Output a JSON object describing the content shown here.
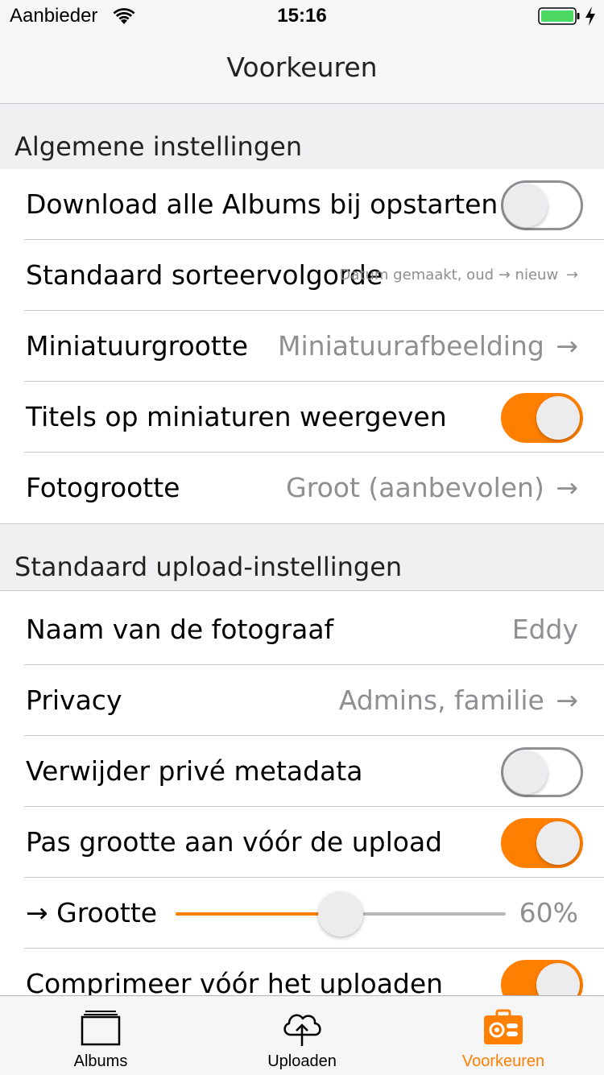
{
  "status_bar": {
    "carrier": "Aanbieder",
    "time": "15:16",
    "battery_color": "#4cd964"
  },
  "nav": {
    "title": "Voorkeuren"
  },
  "accent_color": "#ff7f00",
  "sections": {
    "general": {
      "header": "Algemene instellingen",
      "download_all": {
        "label": "Download alle Albums bij opstarten",
        "on": false
      },
      "sort_order": {
        "label": "Standaard sorteervolgorde",
        "value": "Datum gemaakt, oud → nieuw",
        "arrow": "→"
      },
      "thumbnail_size": {
        "label": "Miniatuurgrootte",
        "value": "Miniatuurafbeelding",
        "arrow": "→"
      },
      "titles_on_thumbs": {
        "label": "Titels op miniaturen weergeven",
        "on": true
      },
      "photo_size": {
        "label": "Fotogrootte",
        "value": "Groot (aanbevolen)",
        "arrow": "→"
      }
    },
    "upload": {
      "header": "Standaard upload-instellingen",
      "photographer": {
        "label": "Naam van de fotograaf",
        "value": "Eddy"
      },
      "privacy": {
        "label": "Privacy",
        "value": "Admins, familie",
        "arrow": "→"
      },
      "strip_metadata": {
        "label": "Verwijder privé metadata",
        "on": false
      },
      "resize": {
        "label": "Pas grootte aan vóór de upload",
        "on": true
      },
      "size": {
        "label": "→ Grootte",
        "value": "60%",
        "fraction": 0.5
      },
      "compress": {
        "label": "Comprimeer vóór het uploaden",
        "on": true
      }
    }
  },
  "tabs": [
    {
      "label": "Albums",
      "icon": "albums-icon",
      "active": false
    },
    {
      "label": "Uploaden",
      "icon": "cloud-upload-icon",
      "active": false
    },
    {
      "label": "Voorkeuren",
      "icon": "settings-briefcase-icon",
      "active": true
    }
  ]
}
